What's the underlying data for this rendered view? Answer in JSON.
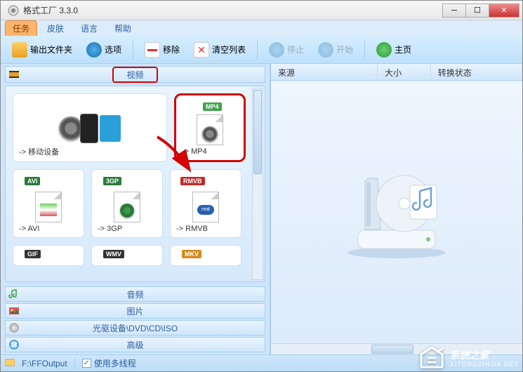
{
  "window": {
    "title": "格式工厂 3.3.0"
  },
  "menu": {
    "task": "任务",
    "skin": "皮肤",
    "lang": "语言",
    "help": "帮助"
  },
  "toolbar": {
    "output_folder": "输出文件夹",
    "options": "选项",
    "remove": "移除",
    "clear": "清空列表",
    "stop": "停止",
    "start": "开始",
    "home": "主页"
  },
  "categories": {
    "video": "视频",
    "audio": "音频",
    "picture": "图片",
    "disc": "光驱设备\\DVD\\CD\\ISO",
    "advanced": "高级"
  },
  "tiles": {
    "mobile": "-> 移动设备",
    "mp4": "-> MP4",
    "mp4_badge": "MP4",
    "avi": "-> AVI",
    "avi_badge": "AVI",
    "gp3": "-> 3GP",
    "gp3_badge": "3GP",
    "rmvb": "-> RMVB",
    "rmvb_badge": "RMVB",
    "gif_badge": "GIF",
    "wmv_badge": "WMV",
    "mkv_badge": "MKV"
  },
  "list": {
    "col_source": "来源",
    "col_size": "大小",
    "col_status": "转换状态"
  },
  "status": {
    "output_path": "F:\\FFOutput",
    "multithread": "使用多线程"
  },
  "watermark": {
    "brand": "系统之家",
    "url": "XITONGZHIJIA.NET"
  }
}
